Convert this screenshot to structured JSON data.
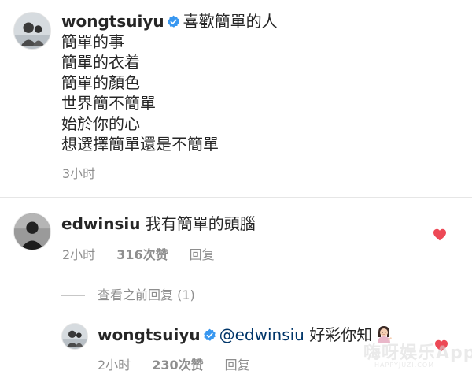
{
  "caption": {
    "avatar_icon": "profile-photo-icon",
    "username": "wongtsuiyu",
    "verified_icon": "verified-badge-icon",
    "first_line": "喜歡簡單的人",
    "lines": [
      "簡單的事",
      "簡單的衣着",
      "簡單的顏色",
      "世界簡不簡單",
      "始於你的心",
      "想選擇簡單還是不簡單"
    ],
    "time": "3小时"
  },
  "comment": {
    "avatar_icon": "profile-photo-icon",
    "username": "edwinsiu",
    "text": "我有簡單的頭腦",
    "time": "2小时",
    "likes": "316次赞",
    "reply_label": "回复",
    "heart_icon": "heart-filled-icon",
    "heart_color": "#ed4956"
  },
  "view_previous": {
    "label": "查看之前回复 (1)"
  },
  "reply": {
    "avatar_icon": "profile-photo-icon",
    "username": "wongtsuiyu",
    "verified_icon": "verified-badge-icon",
    "mention": "@edwinsiu",
    "text": "好彩你知",
    "emoji_icon": "woman-tipping-hand-emoji-icon",
    "time": "2小时",
    "likes": "230次赞",
    "reply_label": "回复",
    "heart_icon": "heart-filled-icon"
  },
  "watermark": {
    "main": "嗨呀娱乐App",
    "sub": "HAPPYJUZI.COM"
  },
  "colors": {
    "text": "#262626",
    "secondary": "#8e8e8e",
    "mention": "#003569",
    "verified": "#3897f0",
    "heart": "#ed4956"
  }
}
